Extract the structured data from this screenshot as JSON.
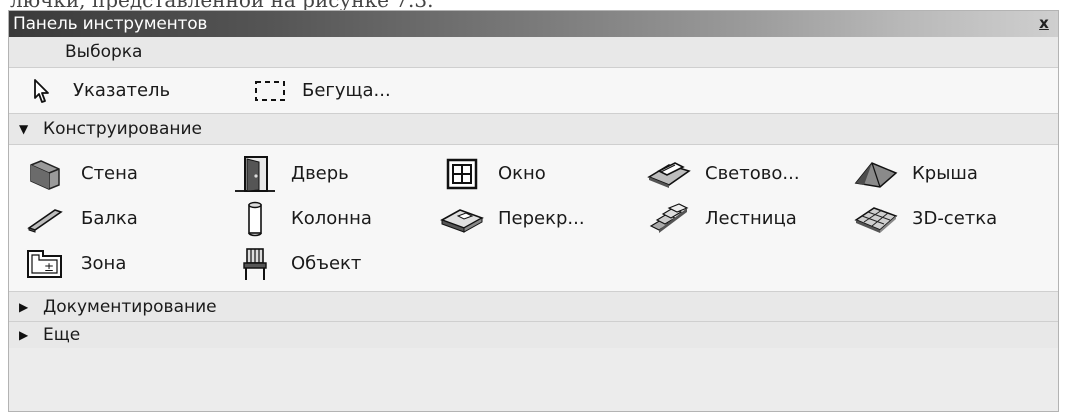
{
  "caption_fragment": "лючки, представленной на рисунке 7.3.",
  "panel": {
    "title": "Панель инструментов",
    "close_glyph": "x"
  },
  "sections": {
    "selection": {
      "label": "Выборка"
    },
    "construction": {
      "label": "Конструирование",
      "expanded": true
    },
    "documentation": {
      "label": "Документирование",
      "expanded": false
    },
    "more": {
      "label": "Еще",
      "expanded": false
    }
  },
  "selection_tools": [
    {
      "label": "Указатель",
      "icon": "pointer-arrow-icon"
    },
    {
      "label": "Бегуща...",
      "icon": "marquee-icon"
    }
  ],
  "construction_tools": [
    [
      {
        "label": "Стена",
        "icon": "wall-icon"
      },
      {
        "label": "Дверь",
        "icon": "door-icon"
      },
      {
        "label": "Окно",
        "icon": "window-icon"
      },
      {
        "label": "Светово...",
        "icon": "skylight-icon"
      },
      {
        "label": "Крыша",
        "icon": "roof-icon"
      }
    ],
    [
      {
        "label": "Балка",
        "icon": "beam-icon"
      },
      {
        "label": "Колонна",
        "icon": "column-icon"
      },
      {
        "label": "Перекр...",
        "icon": "slab-icon"
      },
      {
        "label": "Лестница",
        "icon": "stair-icon"
      },
      {
        "label": "3D-сетка",
        "icon": "mesh-icon"
      }
    ],
    [
      {
        "label": "Зона",
        "icon": "zone-icon"
      },
      {
        "label": "Объект",
        "icon": "object-icon"
      }
    ]
  ]
}
